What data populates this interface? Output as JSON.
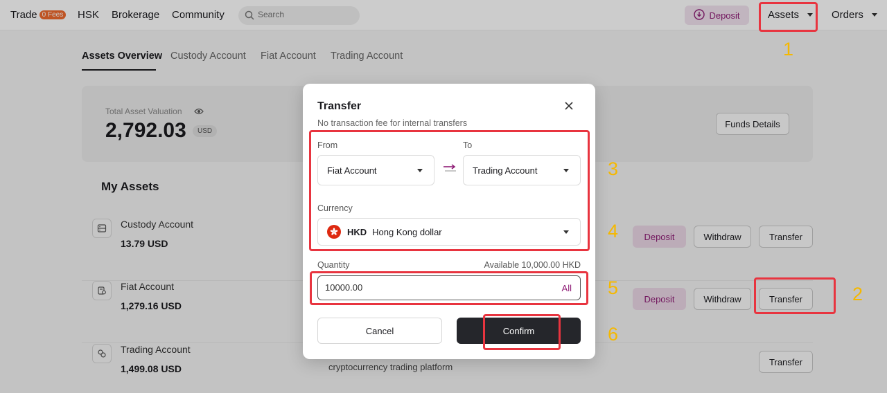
{
  "nav": {
    "trade": "Trade",
    "fees_badge": "0 Fees",
    "hsk": "HSK",
    "brokerage": "Brokerage",
    "community": "Community",
    "search_placeholder": "Search",
    "deposit": "Deposit",
    "assets": "Assets",
    "orders": "Orders"
  },
  "tabs": [
    "Assets Overview",
    "Custody Account",
    "Fiat Account",
    "Trading Account"
  ],
  "summary": {
    "label": "Total Asset Valuation",
    "value": "2,792.03",
    "currency": "USD",
    "funds_details": "Funds Details"
  },
  "my_assets": {
    "title": "My Assets",
    "accounts": [
      {
        "name": "Custody Account",
        "value": "13.79 USD",
        "icon": "custody-icon"
      },
      {
        "name": "Fiat Account",
        "value": "1,279.16 USD",
        "icon": "fiat-icon"
      },
      {
        "name": "Trading Account",
        "value": "1,499.08 USD",
        "icon": "trading-icon"
      }
    ],
    "trading_desc": "cryptocurrency trading platform",
    "buttons": {
      "deposit": "Deposit",
      "withdraw": "Withdraw",
      "transfer": "Transfer"
    }
  },
  "modal": {
    "title": "Transfer",
    "subtitle": "No transaction fee for internal transfers",
    "from_label": "From",
    "from_value": "Fiat Account",
    "to_label": "To",
    "to_value": "Trading Account",
    "currency_label": "Currency",
    "currency_code": "HKD",
    "currency_name": "Hong Kong dollar",
    "quantity_label": "Quantity",
    "available": "Available 10,000.00 HKD",
    "quantity_value": "10000.00",
    "all": "All",
    "cancel": "Cancel",
    "confirm": "Confirm"
  },
  "annotations": [
    "1",
    "2",
    "3",
    "4",
    "5",
    "6"
  ],
  "colors": {
    "accent": "#8f1d76",
    "annotation_box": "#e8343f",
    "annotation_number": "#f5b800",
    "confirm_bg": "#25262b"
  }
}
